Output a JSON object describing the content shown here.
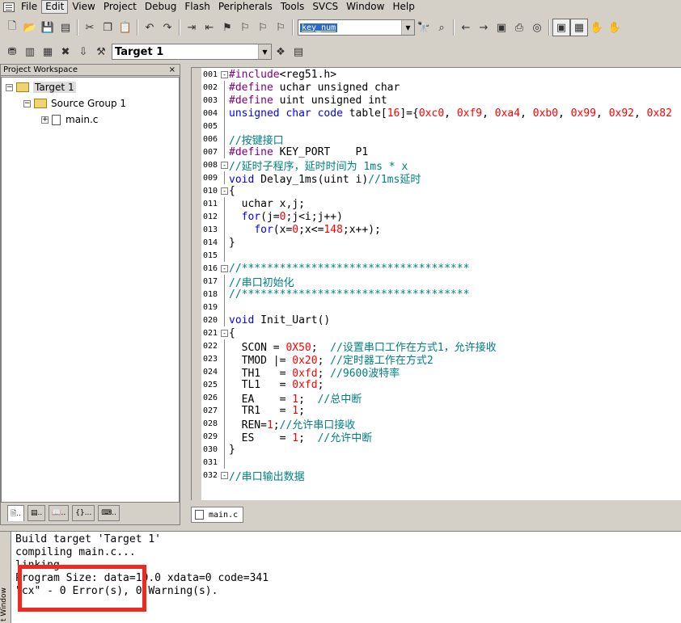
{
  "menubar": {
    "items": [
      "File",
      "Edit",
      "View",
      "Project",
      "Debug",
      "Flash",
      "Peripherals",
      "Tools",
      "SVCS",
      "Window",
      "Help"
    ]
  },
  "toolbar": {
    "find_value": "key_num",
    "target_value": "Target 1"
  },
  "workspace": {
    "title": "Project Workspace",
    "close": "×",
    "tree": {
      "target": "Target 1",
      "group": "Source Group 1",
      "file": "main.c"
    },
    "tabs": [
      "..",
      "..",
      "..",
      "{}...",
      ".."
    ]
  },
  "editor": {
    "tab": "main.c",
    "lines": [
      {
        "n": "001",
        "fold": "-",
        "code": "#include<reg51.h>"
      },
      {
        "n": "002",
        "fold": "",
        "code": "#define uchar unsigned char"
      },
      {
        "n": "003",
        "fold": "",
        "code": "#define uint unsigned int"
      },
      {
        "n": "004",
        "fold": "",
        "code": "unsigned char code table[16]={0xc0, 0xf9, 0xa4, 0xb0, 0x99, 0x92, 0x82"
      },
      {
        "n": "005",
        "fold": "",
        "code": ""
      },
      {
        "n": "006",
        "fold": "",
        "code": "//按键接口"
      },
      {
        "n": "007",
        "fold": "",
        "code": "#define KEY_PORT    P1"
      },
      {
        "n": "008",
        "fold": "-",
        "code": "//延时子程序，延时时间为 1ms * x"
      },
      {
        "n": "009",
        "fold": "",
        "code": "void Delay_1ms(uint i)//1ms延时"
      },
      {
        "n": "010",
        "fold": "-",
        "code": "{"
      },
      {
        "n": "011",
        "fold": "",
        "code": "  uchar x,j;"
      },
      {
        "n": "012",
        "fold": "",
        "code": "  for(j=0;j<i;j++)"
      },
      {
        "n": "013",
        "fold": "",
        "code": "    for(x=0;x<=148;x++);"
      },
      {
        "n": "014",
        "fold": "",
        "code": "}"
      },
      {
        "n": "015",
        "fold": "",
        "code": ""
      },
      {
        "n": "016",
        "fold": "-",
        "code": "//************************************"
      },
      {
        "n": "017",
        "fold": "",
        "code": "//串口初始化"
      },
      {
        "n": "018",
        "fold": "",
        "code": "//************************************"
      },
      {
        "n": "019",
        "fold": "",
        "code": ""
      },
      {
        "n": "020",
        "fold": "",
        "code": "void Init_Uart()"
      },
      {
        "n": "021",
        "fold": "-",
        "code": "{"
      },
      {
        "n": "022",
        "fold": "",
        "code": "  SCON = 0X50;  //设置串口工作在方式1，允许接收"
      },
      {
        "n": "023",
        "fold": "",
        "code": "  TMOD |= 0x20; //定时器工作在方式2"
      },
      {
        "n": "024",
        "fold": "",
        "code": "  TH1   = 0xfd; //9600波特率"
      },
      {
        "n": "025",
        "fold": "",
        "code": "  TL1   = 0xfd;"
      },
      {
        "n": "026",
        "fold": "",
        "code": "  EA    = 1;  //总中断"
      },
      {
        "n": "027",
        "fold": "",
        "code": "  TR1   = 1;"
      },
      {
        "n": "028",
        "fold": "",
        "code": "  REN=1;//允许串口接收"
      },
      {
        "n": "029",
        "fold": "",
        "code": "  ES    = 1;  //允许中断"
      },
      {
        "n": "030",
        "fold": "",
        "code": "}"
      },
      {
        "n": "031",
        "fold": "",
        "code": ""
      },
      {
        "n": "032",
        "fold": "-",
        "code": "//串口输出数据"
      }
    ]
  },
  "output": {
    "side_label": "t Window",
    "lines": [
      "Build target 'Target 1'",
      "compiling main.c...",
      "linking...",
      "Program Size: data=10.0 xdata=0 code=341",
      "\"cx\" - 0 Error(s), 0 Warning(s)."
    ]
  },
  "colors": {
    "highlight_box": "#f0291f",
    "keyword": "#0000ff",
    "preprocessor": "#800080",
    "number": "#ff0000",
    "comment": "#008080"
  }
}
